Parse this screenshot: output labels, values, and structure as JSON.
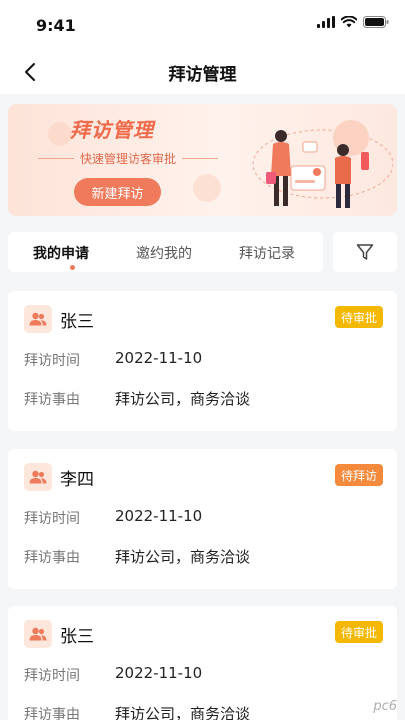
{
  "status_bar": {
    "time": "9:41"
  },
  "nav": {
    "title": "拜访管理"
  },
  "banner": {
    "title": "拜访管理",
    "subtitle": "快速管理访客审批",
    "button_label": "新建拜访"
  },
  "tabs": [
    {
      "label": "我的申请",
      "active": true
    },
    {
      "label": "邀约我的",
      "active": false
    },
    {
      "label": "拜访记录",
      "active": false
    }
  ],
  "cards": [
    {
      "name": "张三",
      "status": "待审批",
      "status_color": "#f5b800",
      "time_label": "拜访时间",
      "time_value": "2022-11-10",
      "reason_label": "拜访事由",
      "reason_value": "拜访公司，商务洽谈"
    },
    {
      "name": "李四",
      "status": "待拜访",
      "status_color": "#f58a3c",
      "time_label": "拜访时间",
      "time_value": "2022-11-10",
      "reason_label": "拜访事由",
      "reason_value": "拜访公司，商务洽谈"
    },
    {
      "name": "张三",
      "status": "待审批",
      "status_color": "#f5b800",
      "time_label": "拜访时间",
      "time_value": "2022-11-10",
      "reason_label": "拜访事由",
      "reason_value": "拜访公司，商务洽谈"
    }
  ],
  "colors": {
    "accent": "#f07a5c",
    "avatar_icon": "#f07a5c"
  },
  "watermark": "pc6"
}
